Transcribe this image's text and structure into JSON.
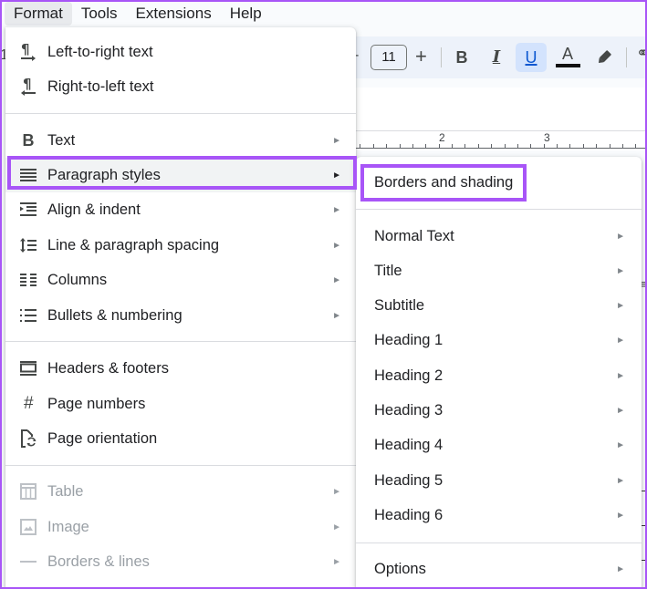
{
  "menubar": {
    "items": [
      {
        "label": "Format",
        "active": true
      },
      {
        "label": "Tools"
      },
      {
        "label": "Extensions"
      },
      {
        "label": "Help"
      }
    ]
  },
  "toolbar": {
    "font_size": "11",
    "plus_label": "+",
    "minus_label": "-",
    "bold_label": "B",
    "italic_label": "I",
    "underline_label": "U",
    "text_color_label": "A",
    "text_color": "#111111",
    "underline_active": true
  },
  "ruler": {
    "labels": [
      "2",
      "3"
    ]
  },
  "format_menu": {
    "groups": [
      [
        {
          "label": "Left-to-right text",
          "icon": "ltr-paragraph-icon"
        },
        {
          "label": "Right-to-left text",
          "icon": "rtl-paragraph-icon"
        }
      ],
      [
        {
          "label": "Text",
          "icon": "bold-icon",
          "submenu": true
        },
        {
          "label": "Paragraph styles",
          "icon": "paragraph-styles-icon",
          "submenu": true,
          "highlighted": true
        },
        {
          "label": "Align & indent",
          "icon": "indent-icon",
          "submenu": true
        },
        {
          "label": "Line & paragraph spacing",
          "icon": "line-spacing-icon",
          "submenu": true
        },
        {
          "label": "Columns",
          "icon": "columns-icon",
          "submenu": true
        },
        {
          "label": "Bullets & numbering",
          "icon": "bulleted-list-icon",
          "submenu": true
        }
      ],
      [
        {
          "label": "Headers & footers",
          "icon": "headers-footers-icon"
        },
        {
          "label": "Page numbers",
          "icon": "hash-icon"
        },
        {
          "label": "Page orientation",
          "icon": "page-orientation-icon"
        }
      ],
      [
        {
          "label": "Table",
          "icon": "table-icon",
          "submenu": true,
          "disabled": true
        },
        {
          "label": "Image",
          "icon": "image-icon",
          "submenu": true,
          "disabled": true
        },
        {
          "label": "Borders & lines",
          "icon": "horizontal-line-icon",
          "submenu": true,
          "disabled": true
        }
      ]
    ],
    "submenu_arrow": "►"
  },
  "paragraph_styles_menu": {
    "top_item": "Borders and shading",
    "styles": [
      "Normal Text",
      "Title",
      "Subtitle",
      "Heading 1",
      "Heading 2",
      "Heading 3",
      "Heading 4",
      "Heading 5",
      "Heading 6"
    ],
    "bottom_item": "Options",
    "submenu_arrow": "►"
  },
  "annotation": {
    "highlight_color": "#a855f7"
  }
}
